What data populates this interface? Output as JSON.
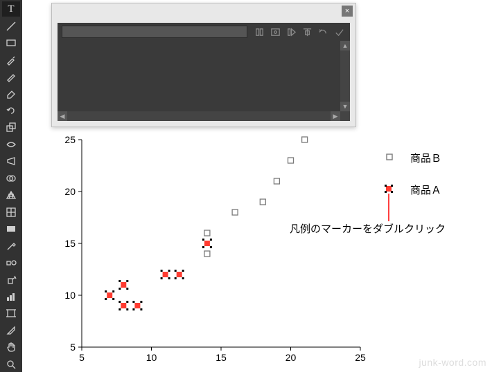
{
  "panel": {
    "close": "×",
    "input_value": ""
  },
  "legend": {
    "itemB": "商品Ｂ",
    "itemA": "商品Ａ"
  },
  "annotation": "凡例のマーカーをダブルクリック",
  "watermark": "junk-word.com",
  "chart_data": {
    "type": "scatter",
    "title": "",
    "xlabel": "",
    "ylabel": "",
    "xlim": [
      5,
      25
    ],
    "ylim": [
      5,
      25
    ],
    "xticks": [
      5,
      10,
      15,
      20,
      25
    ],
    "yticks": [
      5,
      10,
      15,
      20,
      25
    ],
    "series": [
      {
        "name": "商品Ｂ",
        "marker": "open-square",
        "color": "#7a7a7a",
        "points": [
          {
            "x": 14,
            "y": 14
          },
          {
            "x": 14,
            "y": 16
          },
          {
            "x": 16,
            "y": 18
          },
          {
            "x": 18,
            "y": 19
          },
          {
            "x": 19,
            "y": 21
          },
          {
            "x": 20,
            "y": 23
          },
          {
            "x": 21,
            "y": 25
          }
        ]
      },
      {
        "name": "商品Ａ",
        "marker": "filled-square-selected",
        "color": "#ff3b30",
        "points": [
          {
            "x": 7,
            "y": 10
          },
          {
            "x": 8,
            "y": 11
          },
          {
            "x": 8,
            "y": 9
          },
          {
            "x": 9,
            "y": 9
          },
          {
            "x": 11,
            "y": 12
          },
          {
            "x": 12,
            "y": 12
          },
          {
            "x": 14,
            "y": 15
          }
        ]
      }
    ]
  }
}
